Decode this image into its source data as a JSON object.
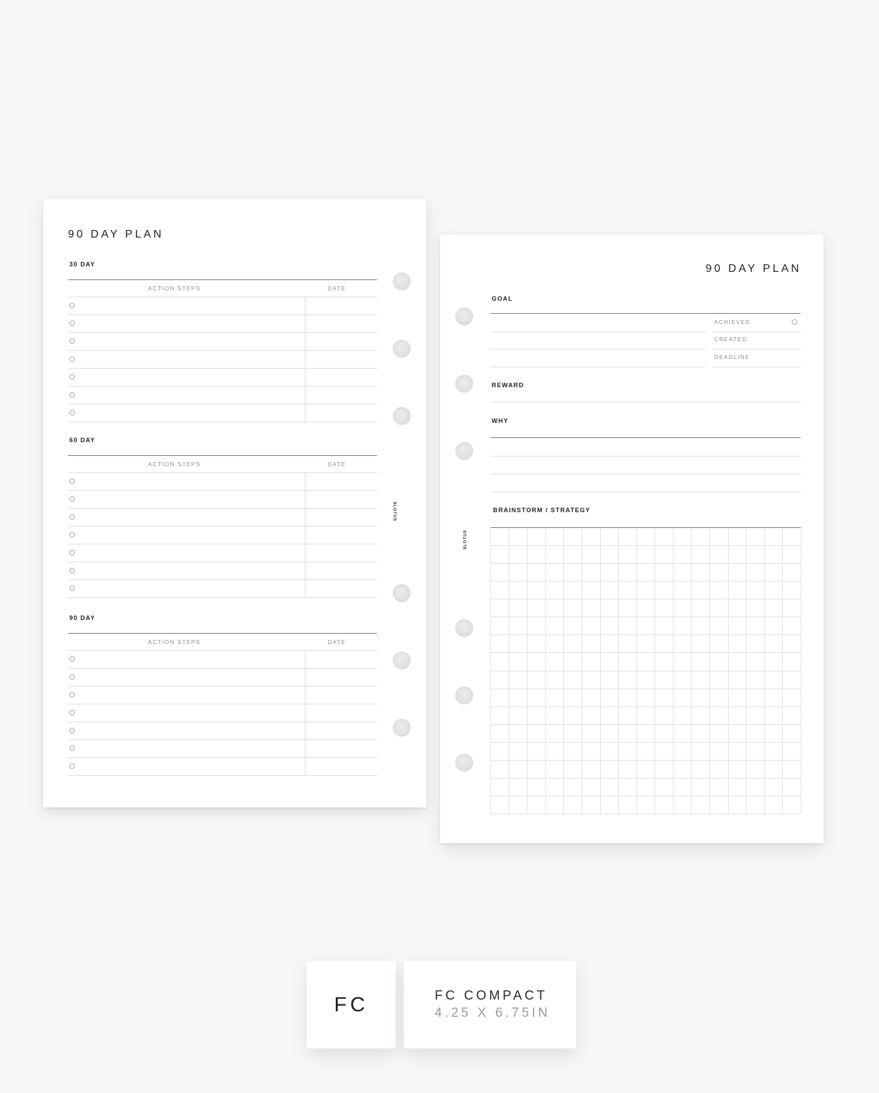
{
  "left_page": {
    "title": "90 DAY PLAN",
    "brand": "8LOTUS",
    "sections": [
      {
        "label": "30 DAY",
        "columns": [
          "ACTION STEPS",
          "DATE"
        ],
        "rows": 7
      },
      {
        "label": "60 DAY",
        "columns": [
          "ACTION STEPS",
          "DATE"
        ],
        "rows": 7
      },
      {
        "label": "90 DAY",
        "columns": [
          "ACTION STEPS",
          "DATE"
        ],
        "rows": 7
      }
    ]
  },
  "right_page": {
    "title": "90 DAY PLAN",
    "brand": "8LOTUS",
    "goal_label": "GOAL",
    "goal_meta": [
      "ACHIEVED",
      "CREATED",
      "DEADLINE"
    ],
    "reward_label": "REWARD",
    "why_label": "WHY",
    "brainstorm_label": "BRAINSTORM / STRATEGY",
    "grid": {
      "columns": 17,
      "rows": 16
    }
  },
  "size_badge": {
    "code": "FC",
    "name": "FC COMPACT",
    "dimensions": "4.25 X 6.75IN"
  },
  "colors": {
    "background": "#f7f7f7",
    "paper": "#ffffff",
    "ink": "#1e1e1e",
    "muted": "#8a8a8a"
  }
}
